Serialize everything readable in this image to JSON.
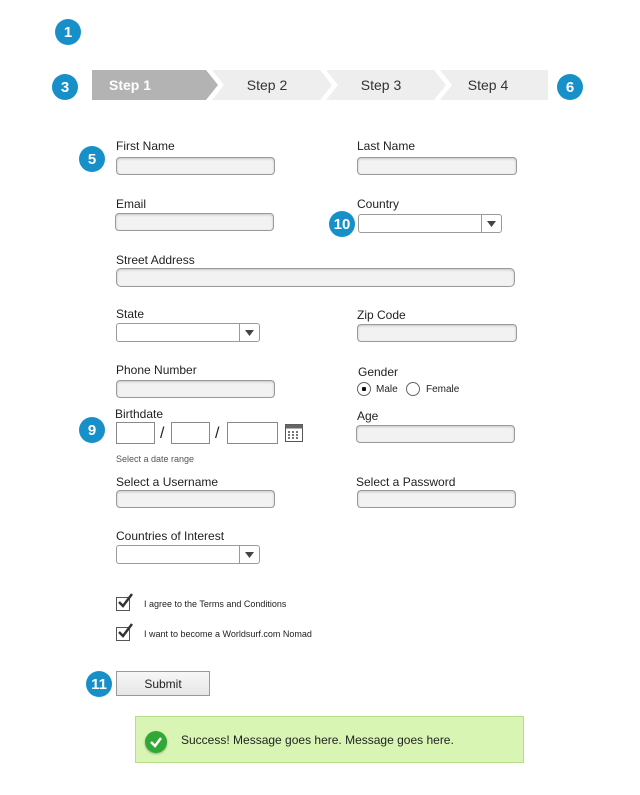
{
  "annotations": {
    "b1": "1",
    "b3": "3",
    "b5": "5",
    "b6": "6",
    "b9": "9",
    "b10": "10",
    "b11": "11"
  },
  "steps": [
    {
      "label": "Step 1",
      "active": true
    },
    {
      "label": "Step 2",
      "active": false
    },
    {
      "label": "Step 3",
      "active": false
    },
    {
      "label": "Step 4",
      "active": false
    }
  ],
  "form": {
    "first_name_label": "First Name",
    "last_name_label": "Last Name",
    "email_label": "Email",
    "country_label": "Country",
    "street_label": "Street Address",
    "state_label": "State",
    "zip_label": "Zip Code",
    "phone_label": "Phone Number",
    "gender_label": "Gender",
    "gender_options": [
      "Male",
      "Female"
    ],
    "gender_selected": "Male",
    "birthdate_label": "Birthdate",
    "date_separator": "/",
    "birthdate_hint": "Select a date range",
    "age_label": "Age",
    "username_label": "Select a Username",
    "password_label": "Select a Password",
    "countries_label": "Countries of Interest",
    "terms_label": "I agree to the Terms and Conditions",
    "nomad_label": "I want to become a Worldsurf.com Nomad",
    "submit_label": "Submit"
  },
  "success": {
    "message": "Success! Message goes here. Message goes here."
  },
  "colors": {
    "badge": "#1790c9",
    "step_active": "#b3b3b3",
    "step_inactive": "#eeeeee",
    "success_bg": "#d8f5b4",
    "success_icon": "#2fa836"
  }
}
